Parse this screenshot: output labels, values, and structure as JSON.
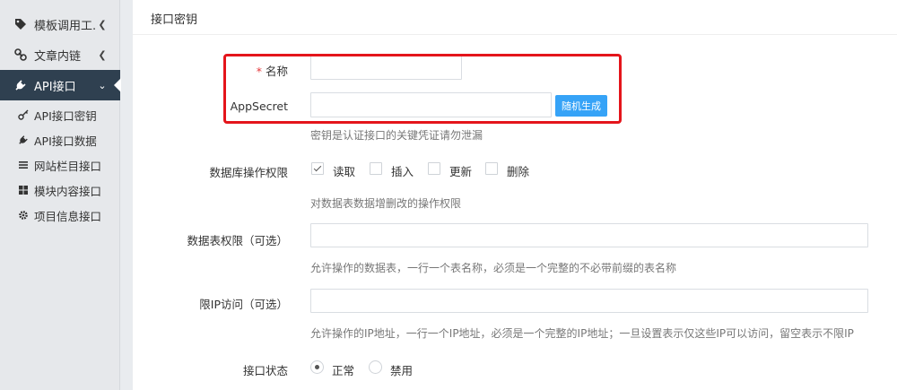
{
  "sidebar": {
    "items": [
      {
        "label": "模板调用工...",
        "icon": "tag-icon",
        "expandable": true
      },
      {
        "label": "文章内链",
        "icon": "link-icon",
        "expandable": true
      },
      {
        "label": "API接口",
        "icon": "plug-icon",
        "expandable": true,
        "active": true
      }
    ],
    "subitems": [
      {
        "label": "API接口密钥",
        "icon": "key-icon"
      },
      {
        "label": "API接口数据",
        "icon": "plug-icon"
      },
      {
        "label": "网站栏目接口",
        "icon": "list-icon"
      },
      {
        "label": "模块内容接口",
        "icon": "grid-icon"
      },
      {
        "label": "项目信息接口",
        "icon": "gear-icon"
      }
    ]
  },
  "page": {
    "title": "接口密钥"
  },
  "form": {
    "name": {
      "required_mark": "*",
      "label": "名称",
      "value": ""
    },
    "appsecret": {
      "label": "AppSecret",
      "value": "",
      "button": "随机生成",
      "help": "密钥是认证接口的关键凭证请勿泄漏"
    },
    "permissions": {
      "label": "数据库操作权限",
      "options": [
        {
          "label": "读取",
          "checked": true
        },
        {
          "label": "插入",
          "checked": false
        },
        {
          "label": "更新",
          "checked": false
        },
        {
          "label": "删除",
          "checked": false
        }
      ],
      "help": "对数据表数据增删改的操作权限"
    },
    "tables": {
      "label": "数据表权限（可选）",
      "value": "",
      "help": "允许操作的数据表，一行一个表名称，必须是一个完整的不必带前缀的表名称"
    },
    "ip": {
      "label": "限IP访问（可选）",
      "value": "",
      "help": "允许操作的IP地址，一行一个IP地址，必须是一个完整的IP地址；一旦设置表示仅这些IP可以访问，留空表示不限IP"
    },
    "status": {
      "label": "接口状态",
      "options": [
        {
          "label": "正常",
          "selected": true
        },
        {
          "label": "禁用",
          "selected": false
        }
      ]
    }
  },
  "colors": {
    "sidebar_active": "#2f4050",
    "button": "#36a3f7",
    "highlight": "#e4151b",
    "required": "#e4393c"
  }
}
